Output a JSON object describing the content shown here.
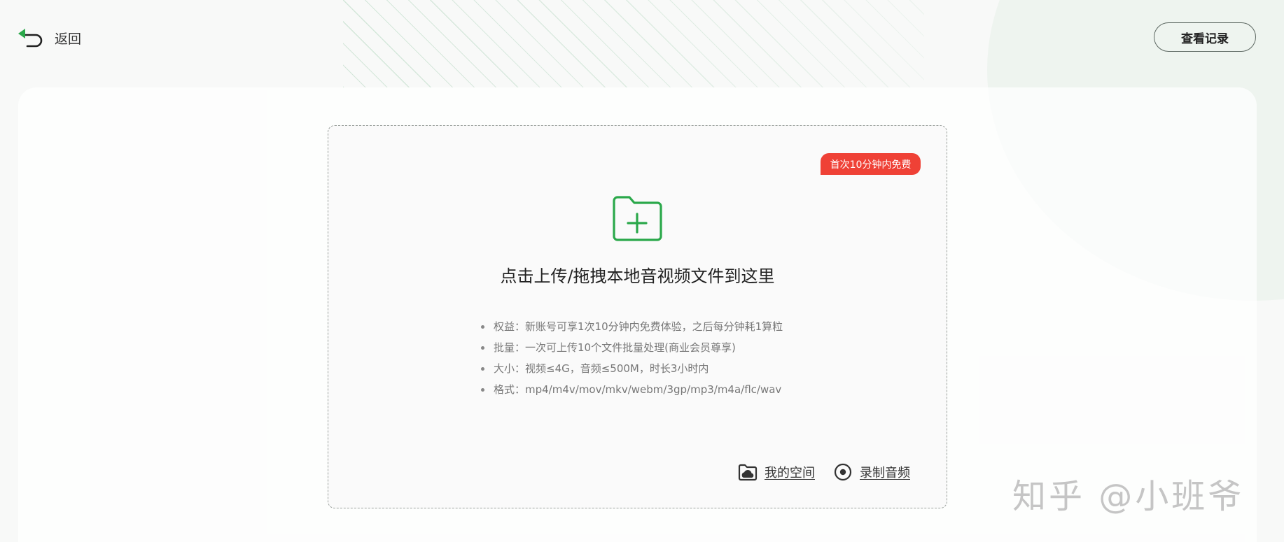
{
  "header": {
    "back_label": "返回",
    "history_button": "查看记录"
  },
  "upload": {
    "badge": "首次10分钟内免费",
    "title": "点击上传/拖拽本地音视频文件到这里",
    "info": [
      "权益：新账号可享1次10分钟内免费体验，之后每分钟耗1算粒",
      "批量：一次可上传10个文件批量处理(商业会员尊享)",
      "大小：视频≤4G，音频≤500M，时长3小时内",
      "格式：mp4/m4v/mov/mkv/webm/3gp/mp3/m4a/flc/wav"
    ],
    "actions": {
      "my_space": "我的空间",
      "record_audio": "录制音频"
    }
  },
  "watermark": "知乎 @小班爷",
  "colors": {
    "accent_green": "#2aa84a",
    "badge_red": "#ef4136"
  },
  "icons": {
    "back": "back-arrow-icon",
    "upload": "folder-plus-icon",
    "my_space": "cloud-folder-icon",
    "record": "record-icon"
  }
}
